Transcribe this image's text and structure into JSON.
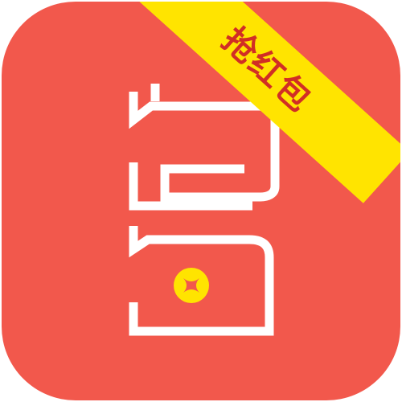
{
  "badge": {
    "label": "抢红包"
  },
  "colors": {
    "background": "#f2584c",
    "ribbon": "#ffe400",
    "ribbon_text": "#d12e25",
    "glyph_stroke": "#ffffff",
    "coin_fill": "#ffe400",
    "coin_symbol": "#f2584c"
  },
  "icons": {
    "main": "stylized-glyph-icon",
    "coin": "coin-icon"
  }
}
